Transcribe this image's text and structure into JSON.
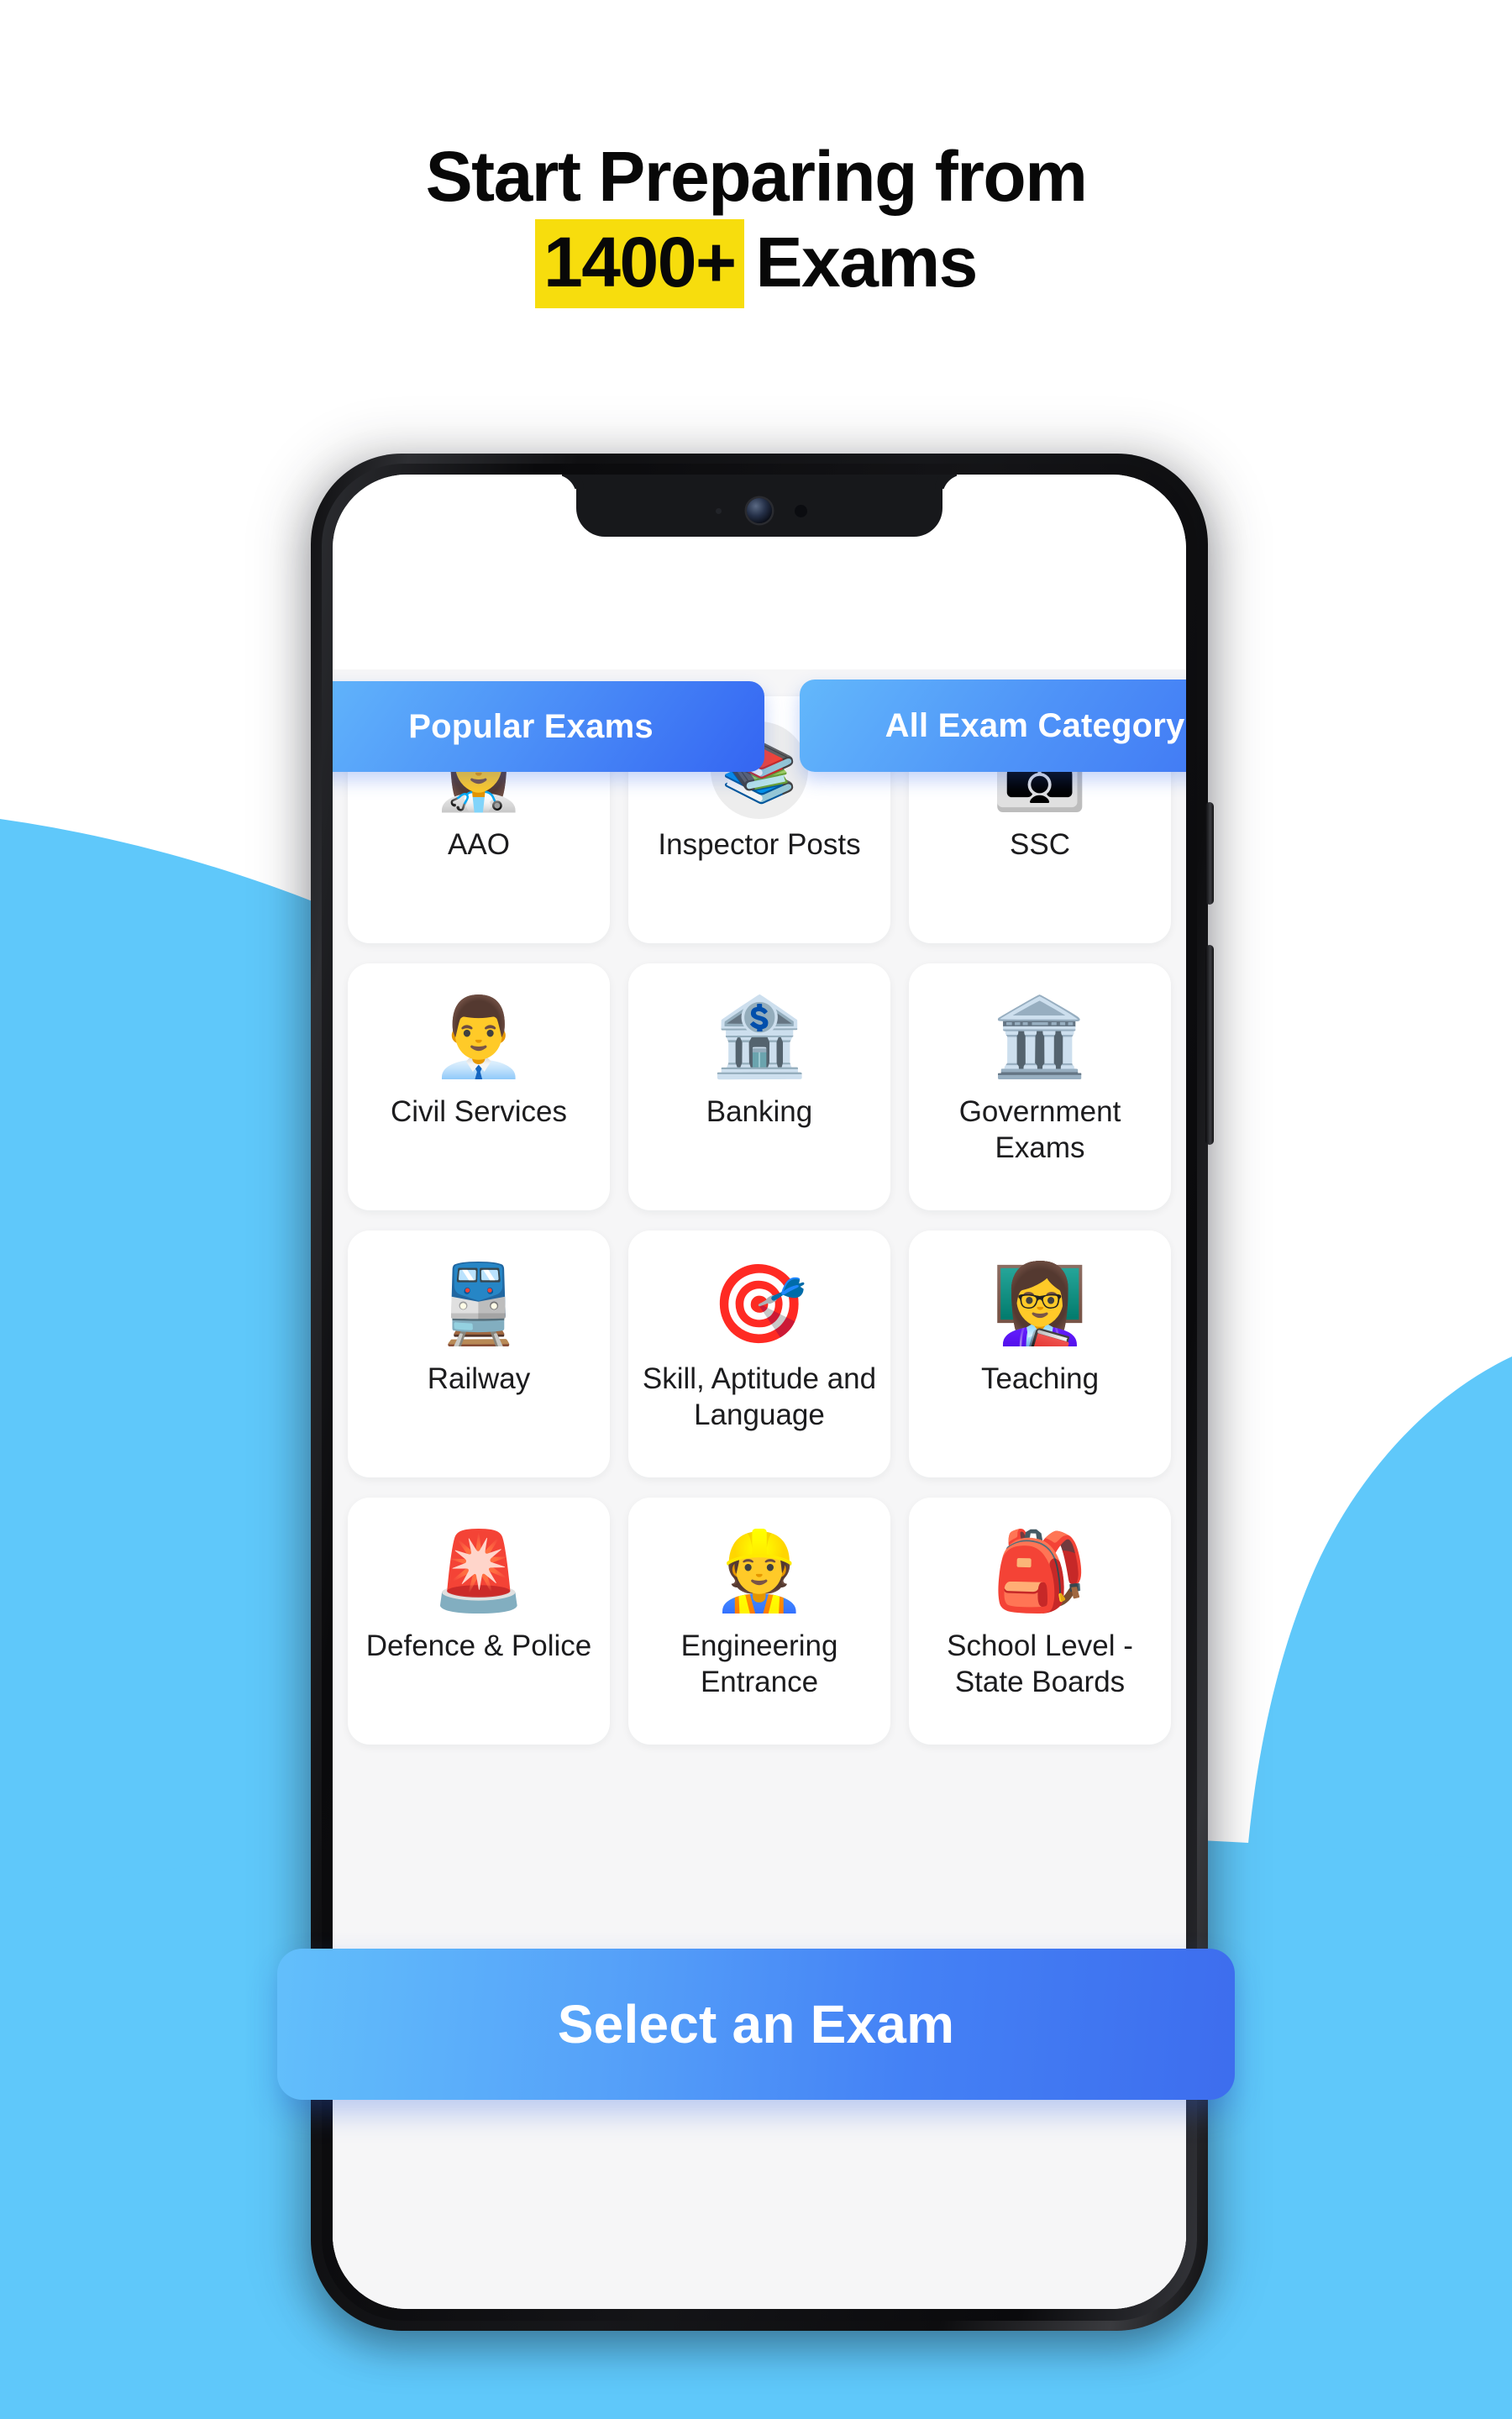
{
  "headline": {
    "line1": "Start Preparing from",
    "highlight": "1400+",
    "line2_rest": "Exams",
    "highlight_color": "#F7DD0D"
  },
  "phone": {
    "notch_camera": "camera-lens",
    "notch_sensor": "proximity-sensor"
  },
  "app": {
    "tabs": [
      {
        "label": "Popular Exams",
        "id": "popular-exams",
        "active": true
      },
      {
        "label": "All Exam Category",
        "id": "all-exam-category",
        "active": false
      }
    ],
    "categories": [
      {
        "label": "AAO",
        "icon": "woman-health-worker-icon",
        "glyph": "👩‍⚕️",
        "badged": false
      },
      {
        "label": "Inspector Posts",
        "icon": "stacked-books-icon",
        "glyph": "📚",
        "badged": true
      },
      {
        "label": "SSC",
        "icon": "group-of-people-icon",
        "glyph": "👪",
        "badged": false
      },
      {
        "label": "Civil Services",
        "icon": "speaker-at-podium-icon",
        "glyph": "👨‍💼",
        "badged": false
      },
      {
        "label": "Banking",
        "icon": "bank-building-icon",
        "glyph": "🏦",
        "badged": false
      },
      {
        "label": "Government Exams",
        "icon": "government-building-flag-icon",
        "glyph": "🏛️",
        "badged": false
      },
      {
        "label": "Railway",
        "icon": "train-icon",
        "glyph": "🚆",
        "badged": false
      },
      {
        "label": "Skill, Aptitude and Language",
        "icon": "dart-target-icon",
        "glyph": "🎯",
        "badged": false
      },
      {
        "label": "Teaching",
        "icon": "teacher-with-book-icon",
        "glyph": "👩‍🏫",
        "badged": false
      },
      {
        "label": "Defence & Police",
        "icon": "police-siren-icon",
        "glyph": "🚨",
        "badged": false
      },
      {
        "label": "Engineering Entrance",
        "icon": "construction-worker-icon",
        "glyph": "👷",
        "badged": false
      },
      {
        "label": "School Level - State Boards",
        "icon": "backpack-icon",
        "glyph": "🎒",
        "badged": false
      }
    ]
  },
  "cta": {
    "label": "Select an Exam",
    "gradient_from": "#62BFFB",
    "gradient_to": "#3D6DEE"
  },
  "theme": {
    "background_blue": "#5FC8FA",
    "page_background": "#FFFFFF",
    "grid_background": "#F6F6F7",
    "tab_gradient_from": "#63B8FB",
    "tab_gradient_to": "#3465F2"
  }
}
